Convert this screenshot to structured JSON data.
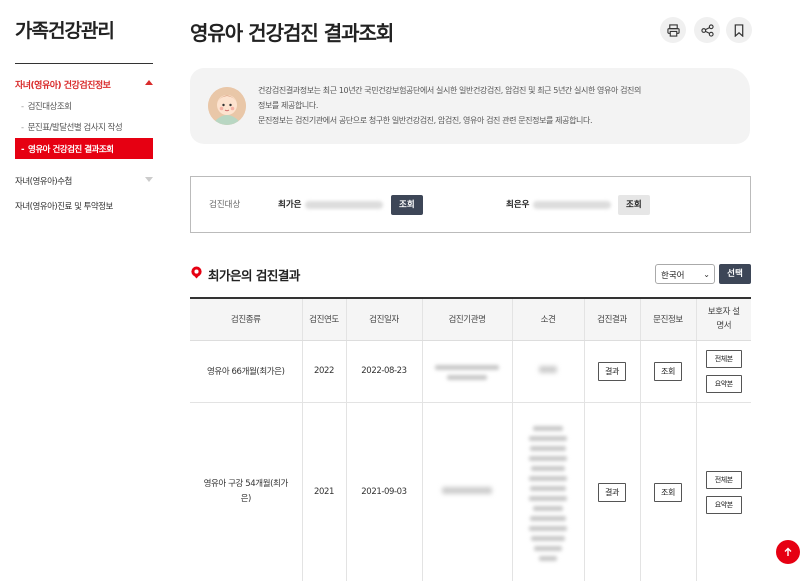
{
  "sidebar": {
    "title": "가족건강관리",
    "active_menu": "자녀(영유아) 건강검진정보",
    "sub_items": [
      "검진대상조회",
      "문진표/발달선별 검사지 작성",
      "영유아 건강검진 결과조회"
    ],
    "menu_items": [
      "자녀(영유아)수첩",
      "자녀(영유아)진료 및 투약정보"
    ]
  },
  "header": {
    "title": "영유아 건강검진 결과조회",
    "tools": [
      "printer-icon",
      "share-icon",
      "bookmark-icon"
    ]
  },
  "info": {
    "line1": "건강검진결과정보는 최근 10년간 국민건강보험공단에서 실시한 일반건강검진, 암검진 및 최근 5년간 실시한 영유아 검진의",
    "line2": "정보를 제공합니다.",
    "line3": "문진정보는 검진기관에서 공단으로 청구한 일반건강검진, 암검진, 영유아 검진 관련 문진정보를 제공합니다."
  },
  "target": {
    "label": "검진대상",
    "persons": [
      {
        "name": "최가은",
        "button": "조회"
      },
      {
        "name": "최은우",
        "button": "조회"
      }
    ]
  },
  "results": {
    "title": "최가은의 검진결과",
    "language": "한국어",
    "select_button": "선택",
    "columns": [
      "검진종류",
      "검진연도",
      "검진일자",
      "검진기관명",
      "소견",
      "검진결과",
      "문진정보",
      "보호자 설명서"
    ],
    "rows": [
      {
        "type": "영유아 66개월(최가은)",
        "year": "2022",
        "date": "2022-08-23",
        "result_btn": "결과",
        "question_btn": "조회",
        "guide_full": "전체본",
        "guide_summary": "요약본"
      },
      {
        "type": "영유아 구강 54개월(최가은)",
        "year": "2021",
        "date": "2021-09-03",
        "result_btn": "결과",
        "question_btn": "조회",
        "guide_full": "전체본",
        "guide_summary": "요약본"
      }
    ]
  },
  "colors": {
    "accent": "#e60012",
    "dark_button": "#3d4657"
  }
}
